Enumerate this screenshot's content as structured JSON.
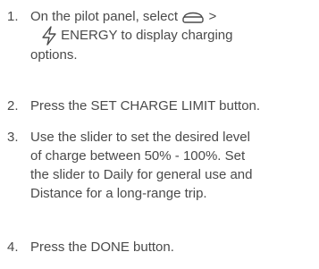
{
  "steps": [
    {
      "number": "1.",
      "line1_prefix": "On the pilot panel, select",
      "line1_suffix": ">",
      "line2": "ENERGY to display charging",
      "line3": "options.",
      "icons": [
        "vehicle-icon",
        "lightning-bolt-icon"
      ]
    },
    {
      "number": "2.",
      "text": "Press the SET CHARGE LIMIT button."
    },
    {
      "number": "3.",
      "lines": [
        "Use the slider to set the desired level",
        "of charge between 50% - 100%. Set",
        "the slider to Daily for general use and",
        "Distance for a long-range trip."
      ]
    },
    {
      "number": "4.",
      "text": "Press the DONE button."
    }
  ]
}
